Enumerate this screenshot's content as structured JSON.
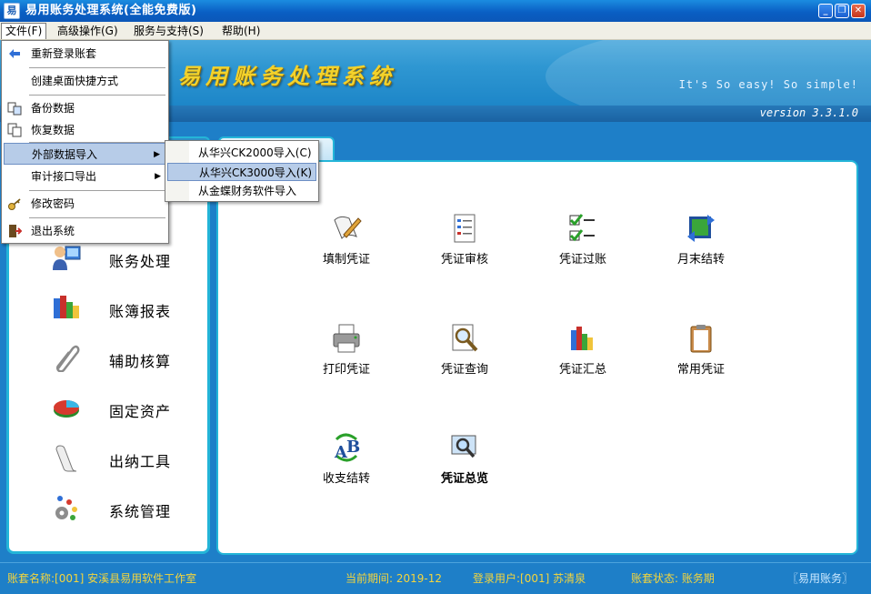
{
  "window": {
    "title": "易用账务处理系统(全能免费版)",
    "app_icon_text": "易",
    "min_glyph": "_",
    "max_glyph": "❐",
    "close_glyph": "✕"
  },
  "menubar": {
    "items": [
      {
        "label": "文件(F)"
      },
      {
        "label": "高级操作(G)"
      },
      {
        "label": "服务与支持(S)"
      },
      {
        "label": "帮助(H)"
      }
    ]
  },
  "banner": {
    "brand": "易用账务处理系统",
    "slogan": "It's So easy! So simple!",
    "version": "version 3.3.1.0"
  },
  "file_menu": {
    "items": [
      {
        "label": "重新登录账套",
        "icon": "relogin-icon"
      },
      {
        "label": "创建桌面快捷方式",
        "icon": ""
      },
      {
        "label": "备份数据",
        "icon": "backup-icon"
      },
      {
        "label": "恢复数据",
        "icon": "restore-icon"
      },
      {
        "label": "外部数据导入",
        "icon": "",
        "has_submenu": true
      },
      {
        "label": "审计接口导出",
        "icon": "",
        "has_submenu": true
      },
      {
        "label": "修改密码",
        "icon": "key-icon"
      },
      {
        "label": "退出系统",
        "icon": "exit-icon"
      }
    ],
    "submenu_arrow": "▶"
  },
  "import_submenu": {
    "items": [
      {
        "label": "从华兴CK2000导入(C)"
      },
      {
        "label": "从华兴CK3000导入(K)"
      },
      {
        "label": "从金蝶财务软件导入"
      }
    ]
  },
  "left_nav": {
    "items": [
      {
        "label": "账务处理",
        "icon": "accounting-icon"
      },
      {
        "label": "账簿报表",
        "icon": "ledger-report-icon"
      },
      {
        "label": "辅助核算",
        "icon": "paperclip-icon"
      },
      {
        "label": "固定资产",
        "icon": "pie-icon"
      },
      {
        "label": "出纳工具",
        "icon": "scroll-icon"
      },
      {
        "label": "系统管理",
        "icon": "gears-icon"
      }
    ]
  },
  "tools": {
    "items": [
      {
        "label": "填制凭证",
        "icon": "fill-voucher-icon"
      },
      {
        "label": "凭证审核",
        "icon": "audit-voucher-icon"
      },
      {
        "label": "凭证过账",
        "icon": "post-voucher-icon"
      },
      {
        "label": "月末结转",
        "icon": "month-end-icon"
      },
      {
        "label": "打印凭证",
        "icon": "printer-icon"
      },
      {
        "label": "凭证查询",
        "icon": "search-voucher-icon"
      },
      {
        "label": "凭证汇总",
        "icon": "summary-icon"
      },
      {
        "label": "常用凭证",
        "icon": "clipboard-icon"
      },
      {
        "label": "收支结转",
        "icon": "ab-transfer-icon"
      },
      {
        "label": "凭证总览",
        "icon": "overview-icon"
      }
    ]
  },
  "status": {
    "account": "账套名称:[001] 安溪县易用软件工作室",
    "period": "当前期间: 2019-12",
    "user": "登录用户:[001] 苏清泉",
    "state": "账套状态: 账务期",
    "brand": "〖易用账务〗"
  },
  "colors": {
    "accent": "#1e7fc8",
    "panel_border": "#24b5d8",
    "status_text": "#f4d53d",
    "brand_text": "#f3d22b"
  }
}
